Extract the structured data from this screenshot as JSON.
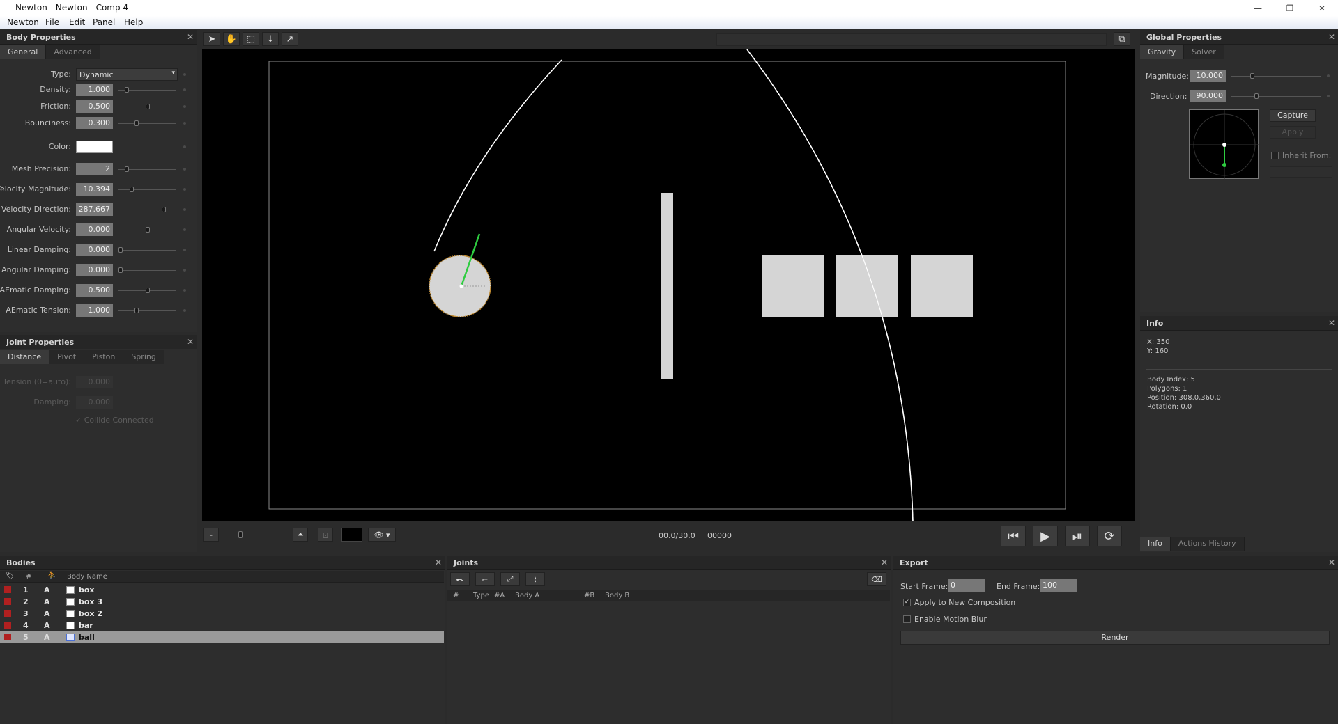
{
  "window": {
    "title": "Newton - Newton - Comp 4",
    "min": "—",
    "restore": "❐",
    "close": "✕"
  },
  "menu": [
    "Newton",
    "File",
    "Edit",
    "Panel",
    "Help"
  ],
  "body_properties": {
    "title": "Body Properties",
    "tabs": [
      "General",
      "Advanced"
    ],
    "type_label": "Type:",
    "type_value": "Dynamic",
    "color_label": "Color:",
    "color_value": "#ffffff",
    "rows": [
      {
        "label": "Density:",
        "value": "1.000",
        "slider": 0.12
      },
      {
        "label": "Friction:",
        "value": "0.500",
        "slider": 0.5
      },
      {
        "label": "Bounciness:",
        "value": "0.300",
        "slider": 0.3
      },
      {
        "label": "Mesh Precision:",
        "value": "2",
        "slider": 0.12
      },
      {
        "label": "Velocity Magnitude:",
        "value": "10.394",
        "slider": 0.2
      },
      {
        "label": "Velocity Direction:",
        "value": "287.667",
        "slider": 0.8
      },
      {
        "label": "Angular Velocity:",
        "value": "0.000",
        "slider": 0.5
      },
      {
        "label": "Linear Damping:",
        "value": "0.000",
        "slider": 0.0
      },
      {
        "label": "Angular Damping:",
        "value": "0.000",
        "slider": 0.0
      },
      {
        "label": "AEmatic Damping:",
        "value": "0.500",
        "slider": 0.5
      },
      {
        "label": "AEmatic Tension:",
        "value": "1.000",
        "slider": 0.3
      }
    ]
  },
  "joint_properties": {
    "title": "Joint Properties",
    "tabs": [
      "Distance",
      "Pivot",
      "Piston",
      "Spring"
    ],
    "rows": [
      {
        "label": "Tension (0=auto):",
        "value": "0.000"
      },
      {
        "label": "Damping:",
        "value": "0.000"
      }
    ],
    "collide_label": "Collide Connected"
  },
  "viewer": {
    "time": "00.0/30.0",
    "frame": "00000",
    "zoom_minus": "-"
  },
  "global_properties": {
    "title": "Global Properties",
    "tabs": [
      "Gravity",
      "Solver"
    ],
    "magnitude_label": "Magnitude:",
    "magnitude_value": "10.000",
    "direction_label": "Direction:",
    "direction_value": "90.000",
    "capture_label": "Capture",
    "apply_label": "Apply",
    "inherit_label": "Inherit From:"
  },
  "info": {
    "title": "Info",
    "x": "X: 350",
    "y": "Y: 160",
    "body_index": "Body Index: 5",
    "polygons": "Polygons: 1",
    "position": "Position: 308.0,360.0",
    "rotation": "Rotation: 0.0",
    "tabs": [
      "Info",
      "Actions History"
    ]
  },
  "bodies": {
    "title": "Bodies",
    "col_num": "#",
    "col_name": "Body Name",
    "rows": [
      {
        "idx": "1",
        "mode": "A",
        "name": "box"
      },
      {
        "idx": "2",
        "mode": "A",
        "name": "box 3"
      },
      {
        "idx": "3",
        "mode": "A",
        "name": "box 2"
      },
      {
        "idx": "4",
        "mode": "A",
        "name": "bar"
      },
      {
        "idx": "5",
        "mode": "A",
        "name": "ball"
      }
    ]
  },
  "joints": {
    "title": "Joints",
    "cols": [
      "#",
      "Type",
      "#A",
      "Body A",
      "#B",
      "Body B"
    ]
  },
  "export": {
    "title": "Export",
    "start_label": "Start Frame:",
    "start_value": "0",
    "end_label": "End Frame:",
    "end_value": "100",
    "apply_new_label": "Apply to New Composition",
    "motion_blur_label": "Enable Motion Blur",
    "render_label": "Render"
  }
}
